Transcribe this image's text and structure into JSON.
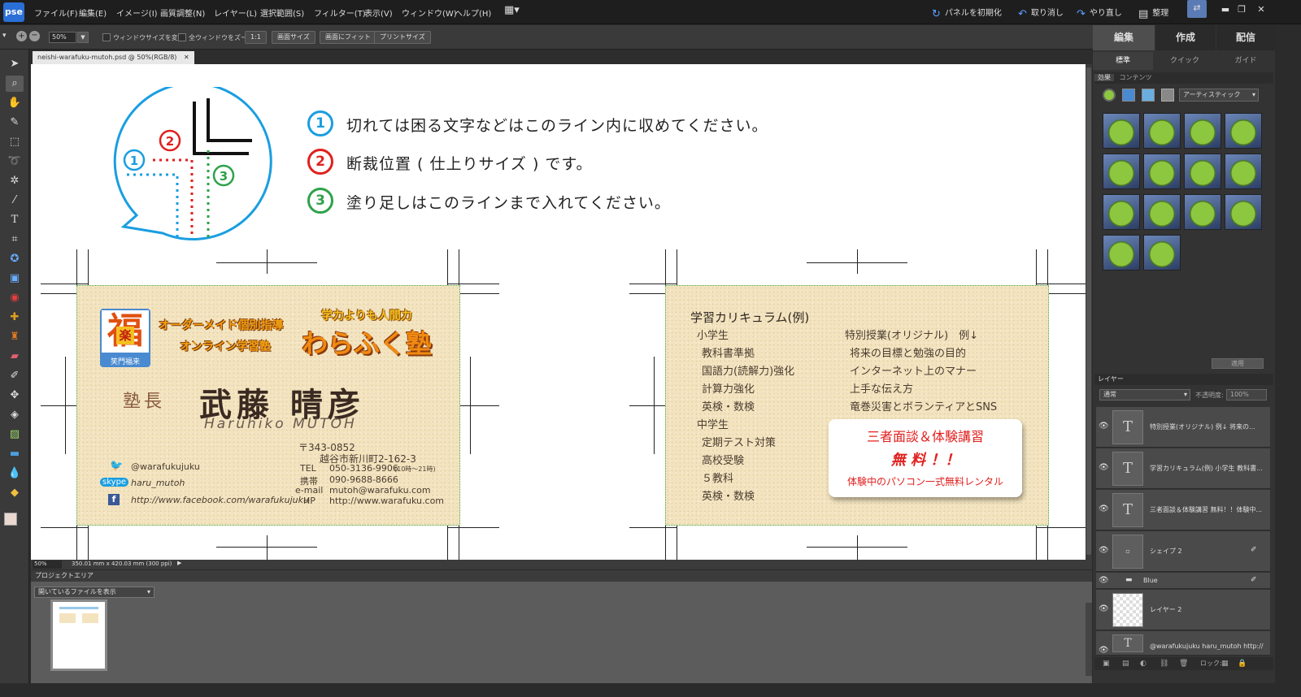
{
  "app": {
    "logo": "pse",
    "menu": [
      "ファイル(F)",
      "編集(E)",
      "イメージ(I)",
      "画質調整(N)",
      "レイヤー(L)",
      "選択範囲(S)",
      "フィルター(T)",
      "表示(V)",
      "ウィンドウ(W)",
      "ヘルプ(H)"
    ],
    "toolbar_right": {
      "reset_panels": "パネルを初期化",
      "undo": "取り消し",
      "redo": "やり直し",
      "organize": "整理"
    }
  },
  "options_bar": {
    "zoom_value": "50%",
    "resize_window": "ウィンドウサイズを変更",
    "zoom_all": "全ウィンドウをズーム",
    "btn_1to1": "1:1",
    "btn_fit_screen": "画面サイズ",
    "btn_fill_screen": "画面にフィット",
    "btn_print_size": "プリントサイズ"
  },
  "document": {
    "tab_title": "neishi-warafuku-mutoh.psd @ 50%(RGB/8)",
    "status_zoom": "50%",
    "status_size": "350.01 mm x 420.03 mm (300 ppi)"
  },
  "guide": {
    "line1": "切れては困る文字などはこのライン内に収めてください。",
    "line2": "断裁位置 ( 仕上りサイズ ) です。",
    "line3": "塗り足しはこのラインまで入れてください。",
    "nums": [
      "1",
      "2",
      "3"
    ],
    "colors": {
      "one": "#1a9ee0",
      "two": "#e0201e",
      "three": "#2ea24a"
    }
  },
  "card_front": {
    "logo_char": "福",
    "logo_sub_char": "楽",
    "logo_caption": "笑門福来",
    "tagline1": "オーダーメイド個別指導",
    "tagline2": "オンライン学習塾",
    "slogan": "学力よりも人間力",
    "school_name": "わらふく塾",
    "title": "塾長",
    "name": "武藤 晴彦",
    "name_roman": "Haruhiko MUTOH",
    "postal": "〒343-0852",
    "address": "越谷市新川町2-162-3",
    "contact_labels": [
      "TEL",
      "携帯",
      "e-mail",
      "HP"
    ],
    "tel": "050-3136-9906",
    "tel_hours": "(10時〜21時)",
    "mobile": "090-9688-8666",
    "email": "mutoh@warafuku.com",
    "hp": "http://www.warafuku.com",
    "twitter": "@warafukujuku",
    "skype_label": "skype",
    "skype": "haru_mutoh",
    "facebook": "http://www.facebook.com/warafukujuku"
  },
  "card_back": {
    "heading": "学習カリキュラム(例)",
    "elementary_label": "小学生",
    "elementary_items": [
      "教科書準拠",
      "国語力(読解力)強化",
      "計算力強化",
      "英検・数検"
    ],
    "junior_label": "中学生",
    "junior_items": [
      "定期テスト対策",
      "高校受験",
      "５教科",
      "英検・数検"
    ],
    "special_label": "特別授業(オリジナル)　例↓",
    "special_items": [
      "将来の目標と勉強の目的",
      "インターネット上のマナー",
      "上手な伝え方",
      "竜巻災害とボランティアとSNS"
    ],
    "promo_title": "三者面談＆体験講習",
    "promo_free": "無 料 ！！",
    "promo_sub": "体験中のパソコン一式無料レンタル"
  },
  "project_bin": {
    "title": "プロジェクトエリア",
    "show_select": "開いているファイルを表示"
  },
  "right_panel": {
    "workspace_tabs": [
      "編集",
      "作成",
      "配信"
    ],
    "sub_tabs": [
      "標準",
      "クイック",
      "ガイド"
    ],
    "effects_tabs": [
      "効果",
      "コンテンツ"
    ],
    "effects_category": "アーティスティック",
    "apply_button": "適用",
    "layers_title": "レイヤー",
    "blend_mode": "通常",
    "opacity_label": "不透明度:",
    "opacity_value": "100%",
    "lock_label": "ロック:",
    "layers": [
      "特別授業(オリジナル) 例↓ 将来の...",
      "学習カリキュラム(例) 小学生 教科書...",
      "三者面談＆体験講習 無料！！体験中...",
      "シェイプ 2",
      "Blue",
      "レイヤー 2",
      "@warafukujuku haru_mutoh http://ww..."
    ]
  }
}
